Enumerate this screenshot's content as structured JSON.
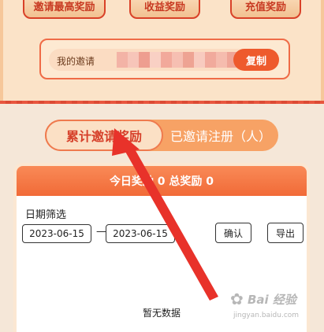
{
  "top_buttons": [
    "邀请最高奖励",
    "收益奖励",
    "充值奖励"
  ],
  "invite": {
    "label": "我的邀请",
    "copy_label": "复制",
    "redaction_colors": [
      "#f3b3a6",
      "#f7c5b9",
      "#ee9e90",
      "#f9d0c4",
      "#f2a99b",
      "#f6bfb2",
      "#eea393",
      "#f8cbbf",
      "#f1aa9c",
      "#f5bcae",
      "#efa597",
      "#f8c7bb",
      "#f3b0a2",
      "#fbd5c9"
    ]
  },
  "toggle": {
    "active": "累计邀请奖励",
    "inactive": "已邀请注册（人）"
  },
  "card": {
    "header": "今日奖励 0 总奖励 0",
    "filter_label": "日期筛选",
    "start_date": "2023-06-15",
    "end_date": "2023-06-15",
    "separator": "—",
    "confirm": "确认",
    "export": "导出",
    "empty_text": "暂无数据"
  },
  "watermark": {
    "brand": "Bai 经验",
    "url": "jingyan.baidu.com"
  },
  "colors": {
    "accent": "#ee5a2d",
    "annotation_arrow": "#e8322a"
  }
}
